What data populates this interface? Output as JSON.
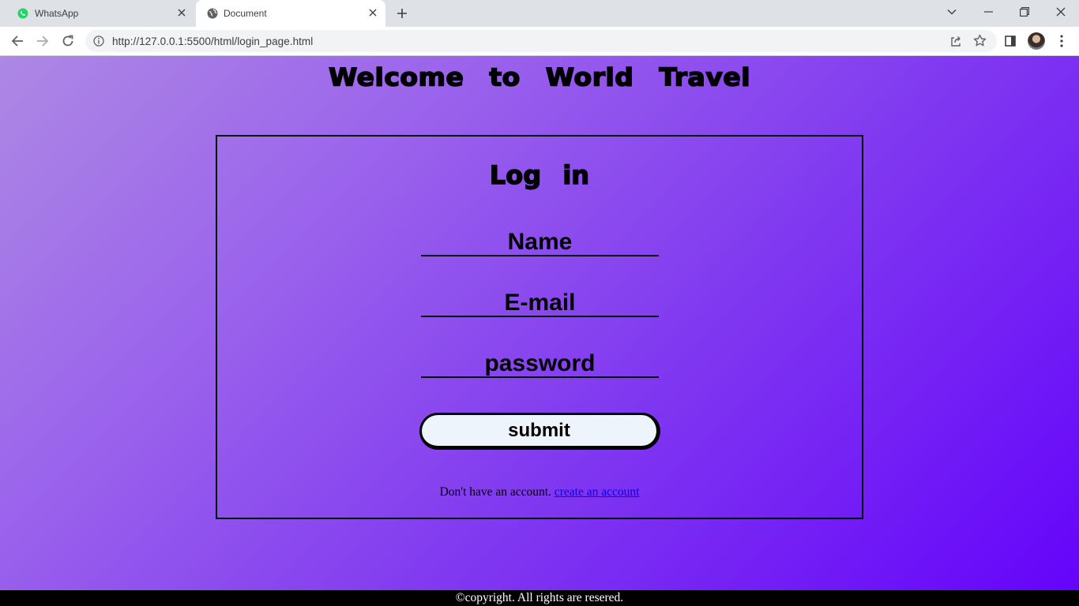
{
  "browser": {
    "tabs": [
      {
        "title": "WhatsApp",
        "icon": "whatsapp-icon",
        "active": false
      },
      {
        "title": "Document",
        "icon": "globe-icon",
        "active": true
      }
    ],
    "url": "http://127.0.0.1:5500/html/login_page.html",
    "accent": "#1a73e8"
  },
  "page": {
    "heading": "Welcome to World Travel",
    "login": {
      "title": "Log in",
      "fields": {
        "name_placeholder": "Name",
        "email_placeholder": "E-mail",
        "password_placeholder": "password"
      },
      "submit_label": "submit",
      "signup_prompt": "Don't have an account.",
      "signup_link": "create an account"
    },
    "footer": "©copyright. All rights are resered.",
    "colors": {
      "gradient_start": "#ad88e4",
      "gradient_end": "#6402fb",
      "button_bg": "#eef4fc",
      "link": "#0000ee"
    }
  }
}
